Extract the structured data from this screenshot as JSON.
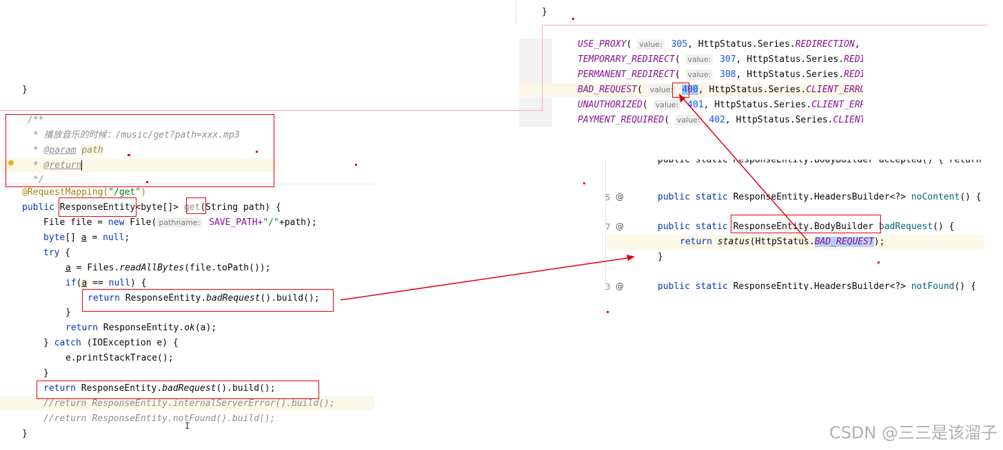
{
  "left_editor": {
    "top_brace": "}",
    "javadoc_open": "/**",
    "javadoc_desc": "* 播放音乐的时候：/music/get?path=xxx.mp3",
    "javadoc_param_tag": "@param",
    "javadoc_param_name": "path",
    "javadoc_return_tag": "@return",
    "javadoc_close": "*/",
    "annotation": "@RequestMapping(",
    "annotation_value": "\"/get\"",
    "annotation_close": ")",
    "sig_public": "public ",
    "sig_type": "ResponseEntity",
    "sig_generic": "<byte[]> ",
    "sig_method": "get",
    "sig_params": "(String path) {",
    "l_file_type": "File file = ",
    "l_file_new": "new",
    "l_file_ctor": " File(",
    "l_file_hint": "pathname:",
    "l_file_arg": " SAVE_PATH+",
    "l_file_str": "\"/\"",
    "l_file_end": "+path);",
    "l_byte_type": "byte",
    "l_byte_decl": "[] ",
    "l_byte_var": "a",
    "l_byte_eq": " = ",
    "l_byte_null": "null",
    "l_byte_end": ";",
    "l_try": "try",
    "l_try_end": " {",
    "l_read_var": "a",
    "l_read_mid": " = Files.",
    "l_read_call": "readAllBytes",
    "l_read_end": "(file.toPath());",
    "l_if": "if",
    "l_if_open": "(",
    "l_if_var": "a",
    "l_if_eq": " == ",
    "l_if_null": "null",
    "l_if_end": ") {",
    "l_ret1_kw": "return",
    "l_ret1_mid": " ResponseEntity.",
    "l_ret1_call": "badRequest",
    "l_ret1_end": "().build();",
    "l_close_if": "}",
    "l_ret_ok_kw": "return",
    "l_ret_ok_mid": " ResponseEntity.",
    "l_ret_ok_call": "ok",
    "l_ret_ok_end": "(a);",
    "l_catch_pre": "} ",
    "l_catch_kw": "catch",
    "l_catch_end": " (IOException e) {",
    "l_stack": "e.printStackTrace();",
    "l_close_try": "}",
    "l_ret2_kw": "return",
    "l_ret2_mid": " ResponseEntity.",
    "l_ret2_call": "badRequest",
    "l_ret2_end": "().build();",
    "l_comment1": "//return ResponseEntity.internalServerError().build();",
    "l_comment2": "//return ResponseEntity.notFound().build();",
    "l_close_method": "}",
    "cursor": "I"
  },
  "top_right_editor": {
    "brace_top": "}",
    "rows": [
      {
        "name": "USE_PROXY",
        "hint": "value:",
        "num": "305",
        "series": "REDIRECTION",
        "tail": ",  "
      },
      {
        "name": "TEMPORARY_REDIRECT",
        "hint": "value:",
        "num": "307",
        "series": "REDIR",
        "tail": ""
      },
      {
        "name": "PERMANENT_REDIRECT",
        "hint": "value:",
        "num": "308",
        "series": "REDIR",
        "tail": ""
      },
      {
        "name": "BAD_REQUEST",
        "hint": "value:",
        "num": "400",
        "series": "CLIENT_ERROR",
        "tail": ""
      },
      {
        "name": "UNAUTHORIZED",
        "hint": "value:",
        "num": "401",
        "series": "CLIENT_ERRO",
        "tail": ""
      },
      {
        "name": "PAYMENT_REQUIRED",
        "hint": "value:",
        "num": "402",
        "series": "CLIENT_",
        "tail": ""
      }
    ],
    "series_prefix": "HttpStatus.Series."
  },
  "bottom_right_editor": {
    "partial_line": "public static ResponseEntity.BodyBuilder accepted() { return",
    "no_content_pre": "public static ",
    "no_content_type": "ResponseEntity.HeadersBuilder<?> ",
    "no_content_name": "noContent",
    "no_content_end": "() {",
    "bad_pre": "public static ",
    "bad_type": "ResponseEntity.BodyBuilder",
    "bad_name": " badRequest",
    "bad_end": "() {",
    "ret_kw": "return",
    "ret_call": " status",
    "ret_mid": "(HttpStatus.",
    "ret_const": "BAD_REQUEST",
    "ret_end": ");",
    "close": "}",
    "not_found_pre": "public static ",
    "not_found_type": "ResponseEntity.HeadersBuilder<?> ",
    "not_found_name": "notFound",
    "not_found_end": "() {",
    "gutter_at": "@",
    "gutter_5": "5",
    "gutter_7": "7",
    "gutter_3": "3"
  },
  "watermark": "CSDN @三三是该溜子",
  "colors": {
    "annotation_box": "#e0000f",
    "arrow": "#e0000f",
    "pink_guide": "#f6a7c0"
  }
}
